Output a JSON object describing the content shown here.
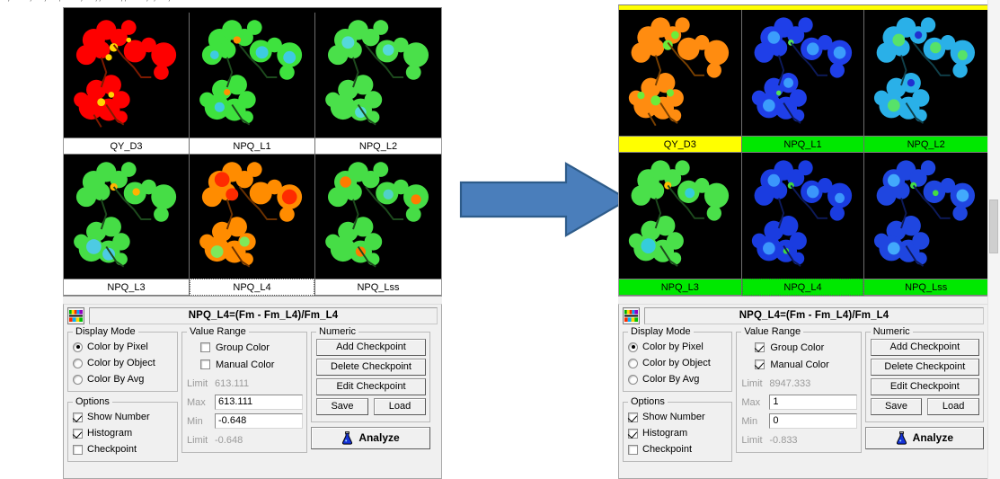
{
  "top_clipped_text": ". , . .  , .  ,  . , . . , . ,, . . ,, . . , ,  .  , . .",
  "arrow": {
    "name": "process-arrow",
    "color": "#4a7ebb",
    "border_color": "#2e5c8a",
    "direction": "right"
  },
  "panels": [
    {
      "id": "before",
      "top_band_color": "#000000",
      "image_grid": {
        "rows": 2,
        "cols": 3,
        "cells": [
          {
            "label": "QY_D3",
            "label_bg": "#ffffff",
            "selected": false,
            "palette": "red"
          },
          {
            "label": "NPQ_L1",
            "label_bg": "#ffffff",
            "selected": false,
            "palette": "green"
          },
          {
            "label": "NPQ_L2",
            "label_bg": "#ffffff",
            "selected": false,
            "palette": "green"
          },
          {
            "label": "NPQ_L3",
            "label_bg": "#ffffff",
            "selected": false,
            "palette": "green"
          },
          {
            "label": "NPQ_L4",
            "label_bg": "#ffffff",
            "selected": true,
            "palette": "orange"
          },
          {
            "label": "NPQ_Lss",
            "label_bg": "#ffffff",
            "selected": false,
            "palette": "green"
          }
        ]
      },
      "formula": "NPQ_L4=(Fm - Fm_L4)/Fm_L4",
      "display_mode": {
        "legend": "Display Mode",
        "options": [
          {
            "label": "Color by Pixel",
            "selected": true
          },
          {
            "label": "Color by Object",
            "selected": false
          },
          {
            "label": "Color By Avg",
            "selected": false
          }
        ]
      },
      "options": {
        "legend": "Options",
        "items": [
          {
            "label": "Show Number",
            "checked": true
          },
          {
            "label": "Histogram",
            "checked": true
          },
          {
            "label": "Checkpoint",
            "checked": false
          }
        ]
      },
      "value_range": {
        "legend": "Value Range",
        "group_color": {
          "label": "Group Color",
          "checked": false
        },
        "manual_color": {
          "label": "Manual Color",
          "checked": false
        },
        "limit_top_label": "Limit",
        "limit_top_value": "613.111",
        "max_label": "Max",
        "max_value": "613.111",
        "min_label": "Min",
        "min_value": "-0.648",
        "limit_bottom_label": "Limit",
        "limit_bottom_value": "-0.648"
      },
      "numeric": {
        "legend": "Numeric",
        "buttons": [
          "Add Checkpoint",
          "Delete Checkpoint",
          "Edit Checkpoint"
        ],
        "save_label": "Save",
        "load_label": "Load"
      },
      "analyze_label": "Analyze"
    },
    {
      "id": "after",
      "top_band_color": "#ffff00",
      "image_grid": {
        "rows": 2,
        "cols": 3,
        "cells": [
          {
            "label": "QY_D3",
            "label_bg": "#ffff00",
            "selected": false,
            "palette": "orange2"
          },
          {
            "label": "NPQ_L1",
            "label_bg": "#00e800",
            "selected": false,
            "palette": "blue"
          },
          {
            "label": "NPQ_L2",
            "label_bg": "#00e800",
            "selected": false,
            "palette": "bluegreen"
          },
          {
            "label": "NPQ_L3",
            "label_bg": "#00e800",
            "selected": false,
            "palette": "green2"
          },
          {
            "label": "NPQ_L4",
            "label_bg": "#00e800",
            "selected": true,
            "palette": "blue2"
          },
          {
            "label": "NPQ_Lss",
            "label_bg": "#00e800",
            "selected": false,
            "palette": "blue3"
          }
        ]
      },
      "formula": "NPQ_L4=(Fm - Fm_L4)/Fm_L4",
      "display_mode": {
        "legend": "Display Mode",
        "options": [
          {
            "label": "Color by Pixel",
            "selected": true
          },
          {
            "label": "Color by Object",
            "selected": false
          },
          {
            "label": "Color By Avg",
            "selected": false
          }
        ]
      },
      "options": {
        "legend": "Options",
        "items": [
          {
            "label": "Show Number",
            "checked": true
          },
          {
            "label": "Histogram",
            "checked": true
          },
          {
            "label": "Checkpoint",
            "checked": false
          }
        ]
      },
      "value_range": {
        "legend": "Value Range",
        "group_color": {
          "label": "Group Color",
          "checked": true
        },
        "manual_color": {
          "label": "Manual Color",
          "checked": true
        },
        "limit_top_label": "Limit",
        "limit_top_value": "8947.333",
        "max_label": "Max",
        "max_value": "1",
        "min_label": "Min",
        "min_value": "0",
        "limit_bottom_label": "Limit",
        "limit_bottom_value": "-0.833"
      },
      "numeric": {
        "legend": "Numeric",
        "buttons": [
          "Add Checkpoint",
          "Delete Checkpoint",
          "Edit Checkpoint"
        ],
        "save_label": "Save",
        "load_label": "Load"
      },
      "analyze_label": "Analyze"
    }
  ]
}
